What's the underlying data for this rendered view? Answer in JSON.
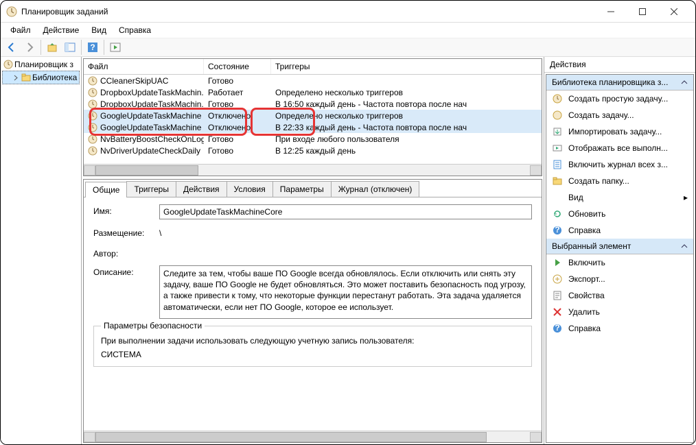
{
  "titlebar": {
    "title": "Планировщик заданий"
  },
  "menu": {
    "file": "Файл",
    "action": "Действие",
    "view": "Вид",
    "help": "Справка"
  },
  "tree": {
    "root": "Планировщик з",
    "library": "Библиотека"
  },
  "columns": {
    "name": "Файл",
    "state": "Состояние",
    "trigger": "Триггеры"
  },
  "tasks": [
    {
      "name": "CCleanerSkipUAC",
      "state": "Готово",
      "trigger": ""
    },
    {
      "name": "DropboxUpdateTaskMachin...",
      "state": "Работает",
      "trigger": "Определено несколько триггеров"
    },
    {
      "name": "DropboxUpdateTaskMachin...",
      "state": "Готово",
      "trigger": "В 16:50 каждый день - Частота повтора после нач"
    },
    {
      "name": "GoogleUpdateTaskMachine",
      "state": "Отключено",
      "trigger": "Определено несколько триггеров",
      "selected": true
    },
    {
      "name": "GoogleUpdateTaskMachine",
      "state": "Отключено",
      "trigger": "В 22:33 каждый день - Частота повтора после нач",
      "selected": true
    },
    {
      "name": "NvBatteryBoostCheckOnLog...",
      "state": "Готово",
      "trigger": "При входе любого пользователя"
    },
    {
      "name": "NvDriverUpdateCheckDaily",
      "state": "Готово",
      "trigger": "В 12:25 каждый день"
    }
  ],
  "tabs": {
    "general": "Общие",
    "triggers": "Триггеры",
    "actions": "Действия",
    "conditions": "Условия",
    "settings": "Параметры",
    "history": "Журнал (отключен)"
  },
  "detail": {
    "name_label": "Имя:",
    "name_value": "GoogleUpdateTaskMachineCore",
    "location_label": "Размещение:",
    "location_value": "\\",
    "author_label": "Автор:",
    "author_value": "",
    "desc_label": "Описание:",
    "desc_value": "Следите за тем, чтобы ваше ПО Google всегда обновлялось. Если отключить или снять эту задачу, ваше ПО Google не будет обновляться. Это может поставить безопасность под угрозу, а также привести к тому, что некоторые функции перестанут работать. Эта задача удаляется автоматически, если нет ПО Google, которое ее использует.",
    "security_legend": "Параметры безопасности",
    "security_text": "При выполнении задачи использовать следующую учетную запись пользователя:",
    "security_account": "СИСТЕМА"
  },
  "actions": {
    "title": "Действия",
    "group1": "Библиотека планировщика з...",
    "group2": "Выбранный элемент",
    "items1": [
      {
        "key": "create-basic",
        "label": "Создать простую задачу..."
      },
      {
        "key": "create",
        "label": "Создать задачу..."
      },
      {
        "key": "import",
        "label": "Импортировать задачу..."
      },
      {
        "key": "show-running",
        "label": "Отображать все выполн..."
      },
      {
        "key": "enable-history",
        "label": "Включить журнал всех з..."
      },
      {
        "key": "new-folder",
        "label": "Создать папку..."
      },
      {
        "key": "view",
        "label": "Вид",
        "submenu": true
      },
      {
        "key": "refresh",
        "label": "Обновить"
      },
      {
        "key": "help1",
        "label": "Справка"
      }
    ],
    "items2": [
      {
        "key": "enable",
        "label": "Включить"
      },
      {
        "key": "export",
        "label": "Экспорт..."
      },
      {
        "key": "properties",
        "label": "Свойства"
      },
      {
        "key": "delete",
        "label": "Удалить"
      },
      {
        "key": "help2",
        "label": "Справка"
      }
    ]
  }
}
